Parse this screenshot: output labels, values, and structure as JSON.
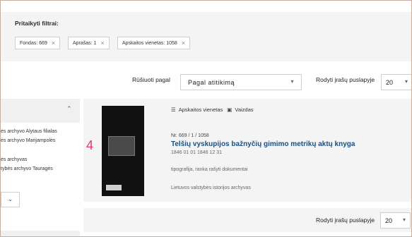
{
  "filters": {
    "title": "Pritaikyti filtrai:",
    "chips": [
      {
        "label": "Fondas: 669"
      },
      {
        "label": "Aprašas: 1"
      },
      {
        "label": "Apskaitos vienetas: 1058"
      }
    ],
    "remove_glyph": "×"
  },
  "sort": {
    "label": "Rūšiuoti pagal",
    "value": "Pagal atitikimą"
  },
  "per_page": {
    "label": "Rodyti įrašų puslapyje",
    "value": "20"
  },
  "sidebar": {
    "items": [
      "ės archyvo Alytaus filialas",
      "ės archyvo Marijampolės",
      "ės archyvas",
      "tybės archyvo Tauragės"
    ]
  },
  "result": {
    "number": "4",
    "tags": [
      "Apskaitos vienetas",
      "Vaizdas"
    ],
    "ref": "Nr. 669 / 1 / 1058",
    "title": "Telšių vyskupijos bažnyčių gimimo metrikų aktų knyga",
    "dates": "1846 01 01   1846 12 31",
    "types": "tipografija, ranka rašyti dokumentai",
    "archive": "Lietuvos valstybės istorijos archyvas"
  },
  "bottom": {
    "per_page_label": "Rodyti įrašų puslapyje",
    "per_page_value": "20"
  }
}
